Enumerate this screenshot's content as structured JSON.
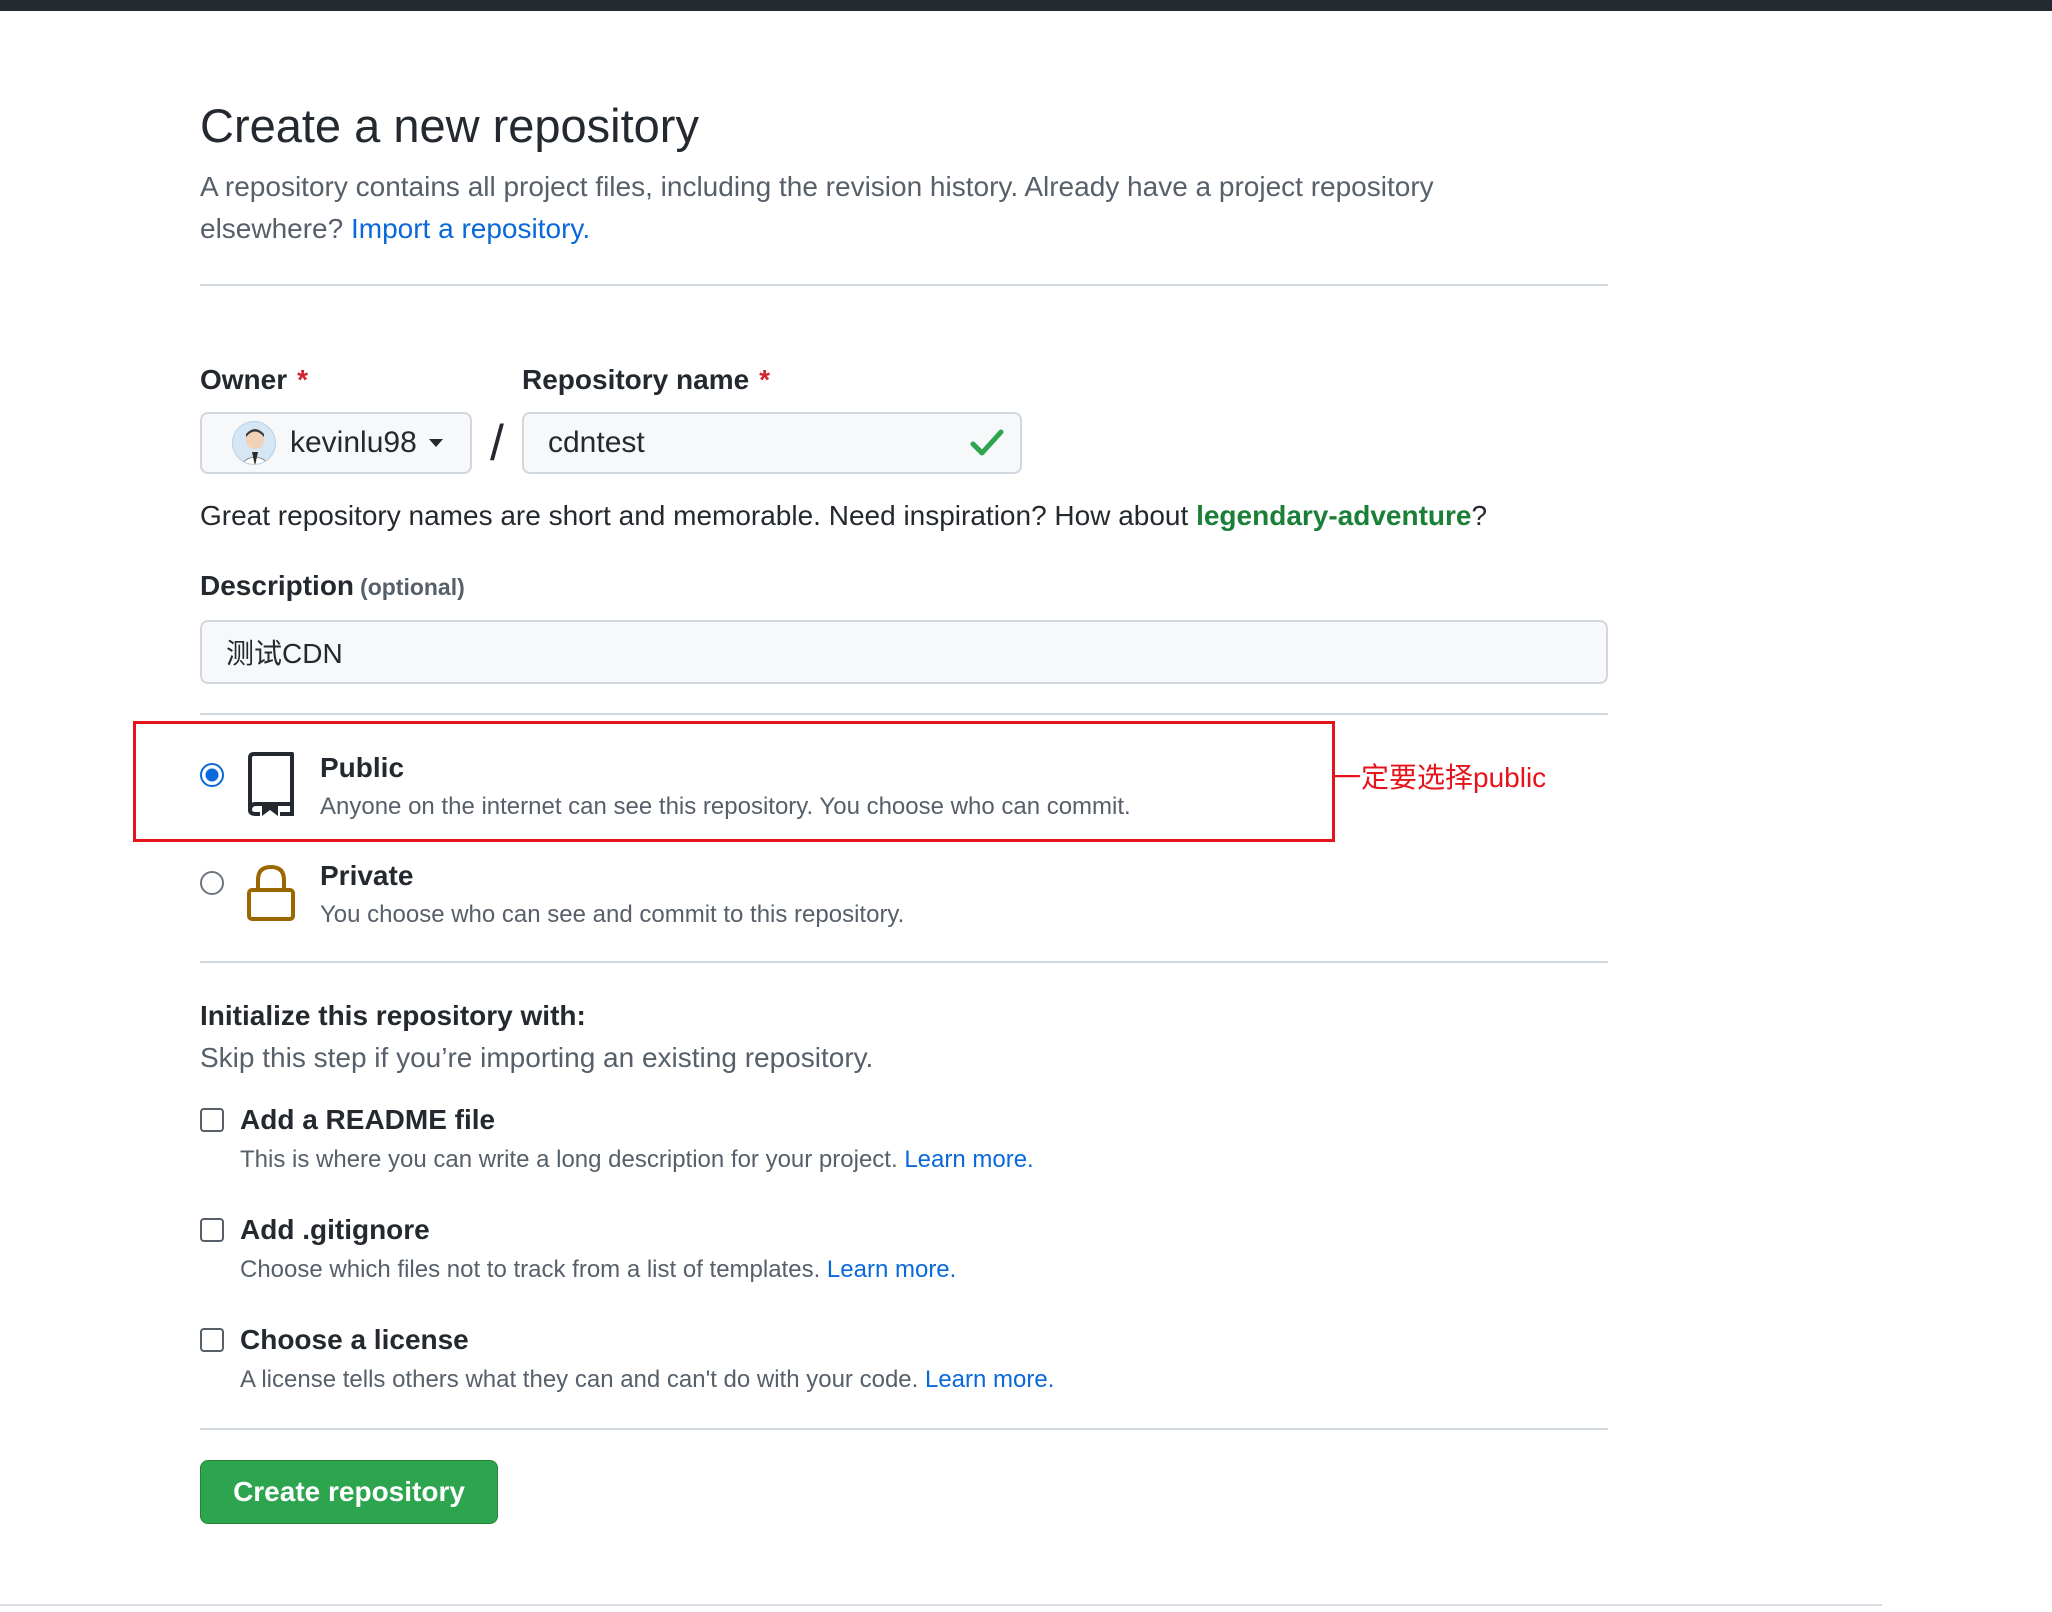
{
  "header": {
    "title": "Create a new repository",
    "subtitle_part1": "A repository contains all project files, including the revision history. Already have a project repository elsewhere?",
    "import_link": "Import a repository."
  },
  "form": {
    "owner_label": "Owner",
    "required_mark": "*",
    "owner_value": "kevinlu98",
    "repo_label": "Repository name",
    "repo_value": "cdntest",
    "slash": "/",
    "hint_text": "Great repository names are short and memorable. Need inspiration? How about",
    "hint_suggestion": "legendary-adventure",
    "hint_end": "?",
    "description_label": "Description",
    "description_optional": "(optional)",
    "description_value": "测试CDN"
  },
  "visibility": {
    "public": {
      "title": "Public",
      "desc": "Anyone on the internet can see this repository. You choose who can commit.",
      "selected": true
    },
    "private": {
      "title": "Private",
      "desc": "You choose who can see and commit to this repository.",
      "selected": false
    },
    "annotation": "一定要选择public"
  },
  "initialize": {
    "title": "Initialize this repository with:",
    "subtitle": "Skip this step if you’re importing an existing repository.",
    "options": [
      {
        "title": "Add a README file",
        "desc": "This is where you can write a long description for your project.",
        "link": "Learn more."
      },
      {
        "title": "Add .gitignore",
        "desc": "Choose which files not to track from a list of templates.",
        "link": "Learn more."
      },
      {
        "title": "Choose a license",
        "desc": "A license tells others what they can and can't do with your code.",
        "link": "Learn more."
      }
    ]
  },
  "submit": {
    "label": "Create repository"
  },
  "colors": {
    "accent_blue": "#0969da",
    "success_green": "#2da44e",
    "annotation_red": "#e5141c",
    "lock_icon": "#9a6700"
  },
  "icons": [
    "caret-down-icon",
    "check-icon",
    "repo-icon",
    "lock-icon"
  ]
}
